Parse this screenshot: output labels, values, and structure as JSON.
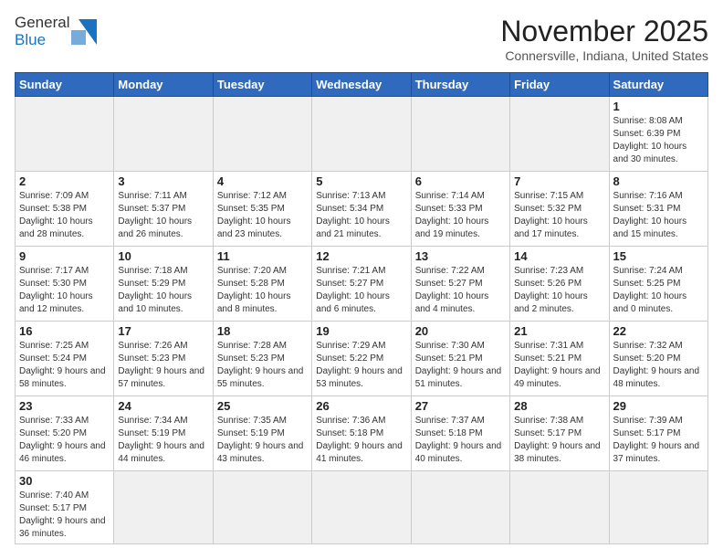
{
  "logo": {
    "line1": "General",
    "line2": "Blue"
  },
  "title": "November 2025",
  "subtitle": "Connersville, Indiana, United States",
  "weekdays": [
    "Sunday",
    "Monday",
    "Tuesday",
    "Wednesday",
    "Thursday",
    "Friday",
    "Saturday"
  ],
  "weeks": [
    [
      {
        "day": "",
        "info": ""
      },
      {
        "day": "",
        "info": ""
      },
      {
        "day": "",
        "info": ""
      },
      {
        "day": "",
        "info": ""
      },
      {
        "day": "",
        "info": ""
      },
      {
        "day": "",
        "info": ""
      },
      {
        "day": "1",
        "info": "Sunrise: 8:08 AM\nSunset: 6:39 PM\nDaylight: 10 hours and 30 minutes."
      }
    ],
    [
      {
        "day": "2",
        "info": "Sunrise: 7:09 AM\nSunset: 5:38 PM\nDaylight: 10 hours and 28 minutes."
      },
      {
        "day": "3",
        "info": "Sunrise: 7:11 AM\nSunset: 5:37 PM\nDaylight: 10 hours and 26 minutes."
      },
      {
        "day": "4",
        "info": "Sunrise: 7:12 AM\nSunset: 5:35 PM\nDaylight: 10 hours and 23 minutes."
      },
      {
        "day": "5",
        "info": "Sunrise: 7:13 AM\nSunset: 5:34 PM\nDaylight: 10 hours and 21 minutes."
      },
      {
        "day": "6",
        "info": "Sunrise: 7:14 AM\nSunset: 5:33 PM\nDaylight: 10 hours and 19 minutes."
      },
      {
        "day": "7",
        "info": "Sunrise: 7:15 AM\nSunset: 5:32 PM\nDaylight: 10 hours and 17 minutes."
      },
      {
        "day": "8",
        "info": "Sunrise: 7:16 AM\nSunset: 5:31 PM\nDaylight: 10 hours and 15 minutes."
      }
    ],
    [
      {
        "day": "9",
        "info": "Sunrise: 7:17 AM\nSunset: 5:30 PM\nDaylight: 10 hours and 12 minutes."
      },
      {
        "day": "10",
        "info": "Sunrise: 7:18 AM\nSunset: 5:29 PM\nDaylight: 10 hours and 10 minutes."
      },
      {
        "day": "11",
        "info": "Sunrise: 7:20 AM\nSunset: 5:28 PM\nDaylight: 10 hours and 8 minutes."
      },
      {
        "day": "12",
        "info": "Sunrise: 7:21 AM\nSunset: 5:27 PM\nDaylight: 10 hours and 6 minutes."
      },
      {
        "day": "13",
        "info": "Sunrise: 7:22 AM\nSunset: 5:27 PM\nDaylight: 10 hours and 4 minutes."
      },
      {
        "day": "14",
        "info": "Sunrise: 7:23 AM\nSunset: 5:26 PM\nDaylight: 10 hours and 2 minutes."
      },
      {
        "day": "15",
        "info": "Sunrise: 7:24 AM\nSunset: 5:25 PM\nDaylight: 10 hours and 0 minutes."
      }
    ],
    [
      {
        "day": "16",
        "info": "Sunrise: 7:25 AM\nSunset: 5:24 PM\nDaylight: 9 hours and 58 minutes."
      },
      {
        "day": "17",
        "info": "Sunrise: 7:26 AM\nSunset: 5:23 PM\nDaylight: 9 hours and 57 minutes."
      },
      {
        "day": "18",
        "info": "Sunrise: 7:28 AM\nSunset: 5:23 PM\nDaylight: 9 hours and 55 minutes."
      },
      {
        "day": "19",
        "info": "Sunrise: 7:29 AM\nSunset: 5:22 PM\nDaylight: 9 hours and 53 minutes."
      },
      {
        "day": "20",
        "info": "Sunrise: 7:30 AM\nSunset: 5:21 PM\nDaylight: 9 hours and 51 minutes."
      },
      {
        "day": "21",
        "info": "Sunrise: 7:31 AM\nSunset: 5:21 PM\nDaylight: 9 hours and 49 minutes."
      },
      {
        "day": "22",
        "info": "Sunrise: 7:32 AM\nSunset: 5:20 PM\nDaylight: 9 hours and 48 minutes."
      }
    ],
    [
      {
        "day": "23",
        "info": "Sunrise: 7:33 AM\nSunset: 5:20 PM\nDaylight: 9 hours and 46 minutes."
      },
      {
        "day": "24",
        "info": "Sunrise: 7:34 AM\nSunset: 5:19 PM\nDaylight: 9 hours and 44 minutes."
      },
      {
        "day": "25",
        "info": "Sunrise: 7:35 AM\nSunset: 5:19 PM\nDaylight: 9 hours and 43 minutes."
      },
      {
        "day": "26",
        "info": "Sunrise: 7:36 AM\nSunset: 5:18 PM\nDaylight: 9 hours and 41 minutes."
      },
      {
        "day": "27",
        "info": "Sunrise: 7:37 AM\nSunset: 5:18 PM\nDaylight: 9 hours and 40 minutes."
      },
      {
        "day": "28",
        "info": "Sunrise: 7:38 AM\nSunset: 5:17 PM\nDaylight: 9 hours and 38 minutes."
      },
      {
        "day": "29",
        "info": "Sunrise: 7:39 AM\nSunset: 5:17 PM\nDaylight: 9 hours and 37 minutes."
      }
    ],
    [
      {
        "day": "30",
        "info": "Sunrise: 7:40 AM\nSunset: 5:17 PM\nDaylight: 9 hours and 36 minutes."
      },
      {
        "day": "",
        "info": ""
      },
      {
        "day": "",
        "info": ""
      },
      {
        "day": "",
        "info": ""
      },
      {
        "day": "",
        "info": ""
      },
      {
        "day": "",
        "info": ""
      },
      {
        "day": "",
        "info": ""
      }
    ]
  ]
}
